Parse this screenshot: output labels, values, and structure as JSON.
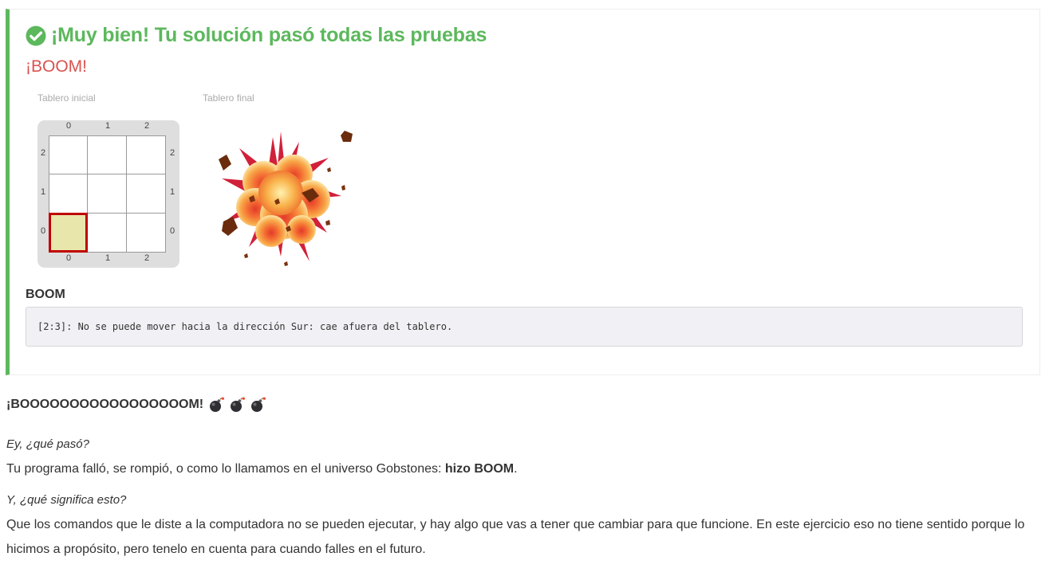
{
  "result": {
    "title": "¡Muy bien! Tu solución pasó todas las pruebas",
    "subtitle": "¡BOOM!",
    "initial_board_caption": "Tablero inicial",
    "final_board_caption": "Tablero final",
    "board": {
      "columns": [
        "0",
        "1",
        "2"
      ],
      "rows": [
        "2",
        "1",
        "0"
      ],
      "head": {
        "x": 0,
        "y": 0
      }
    },
    "error_heading": "BOOM",
    "error_message": "[2:3]: No se puede mover hacia la dirección Sur: cae afuera del tablero."
  },
  "explanation": {
    "headline": "¡BOOOOOOOOOOOOOOOOOM!",
    "headline_icons": [
      "bomb-icon",
      "bomb-icon",
      "bomb-icon"
    ],
    "question1": "Ey, ¿qué pasó?",
    "answer1_prefix": "Tu programa falló, se rompió, o como lo llamamos en el universo Gobstones: ",
    "answer1_bold": "hizo BOOM",
    "answer1_suffix": ".",
    "question2": "Y, ¿qué significa esto?",
    "answer2": "Que los comandos que le diste a la computadora no se pueden ejecutar, y hay algo que vas a tener que cambiar para que funcione. En este ejercicio eso no tiene sentido porque lo hicimos a propósito, pero tenelo en cuenta para cuando falles en el futuro."
  },
  "colors": {
    "success": "#5cb85c",
    "danger": "#d9534f",
    "head_border": "#c00000",
    "head_fill": "#e8e6ab"
  }
}
